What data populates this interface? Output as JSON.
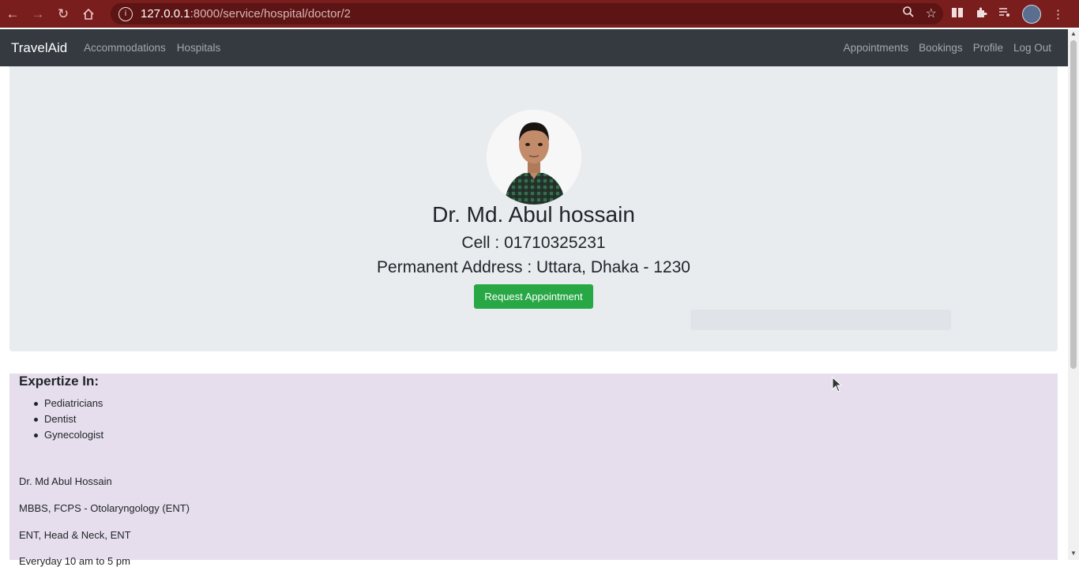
{
  "browser": {
    "url_host": "127.0.0.1",
    "url_path": ":8000/service/hospital/doctor/2"
  },
  "navbar": {
    "brand": "TravelAid",
    "left_links": [
      "Accommodations",
      "Hospitals"
    ],
    "right_links": [
      "Appointments",
      "Bookings",
      "Profile",
      "Log Out"
    ]
  },
  "doctor": {
    "name": "Dr. Md. Abul hossain",
    "cell": "Cell : 01710325231",
    "address": "Permanent Address : Uttara, Dhaka - 1230",
    "request_button": "Request Appointment"
  },
  "expertise": {
    "title": "Expertize In:",
    "items": [
      "Pediatricians",
      "Dentist",
      "Gynecologist"
    ]
  },
  "info_lines": [
    "Dr. Md Abul Hossain",
    "MBBS, FCPS - Otolaryngology (ENT)",
    "ENT, Head & Neck, ENT",
    "Everyday 10 am to 5 pm"
  ],
  "colors": {
    "chrome": "#7a1d1d",
    "navbar": "#343a40",
    "jumbotron": "#e9ecef",
    "details_bg": "#e6deed",
    "success": "#28a745"
  }
}
